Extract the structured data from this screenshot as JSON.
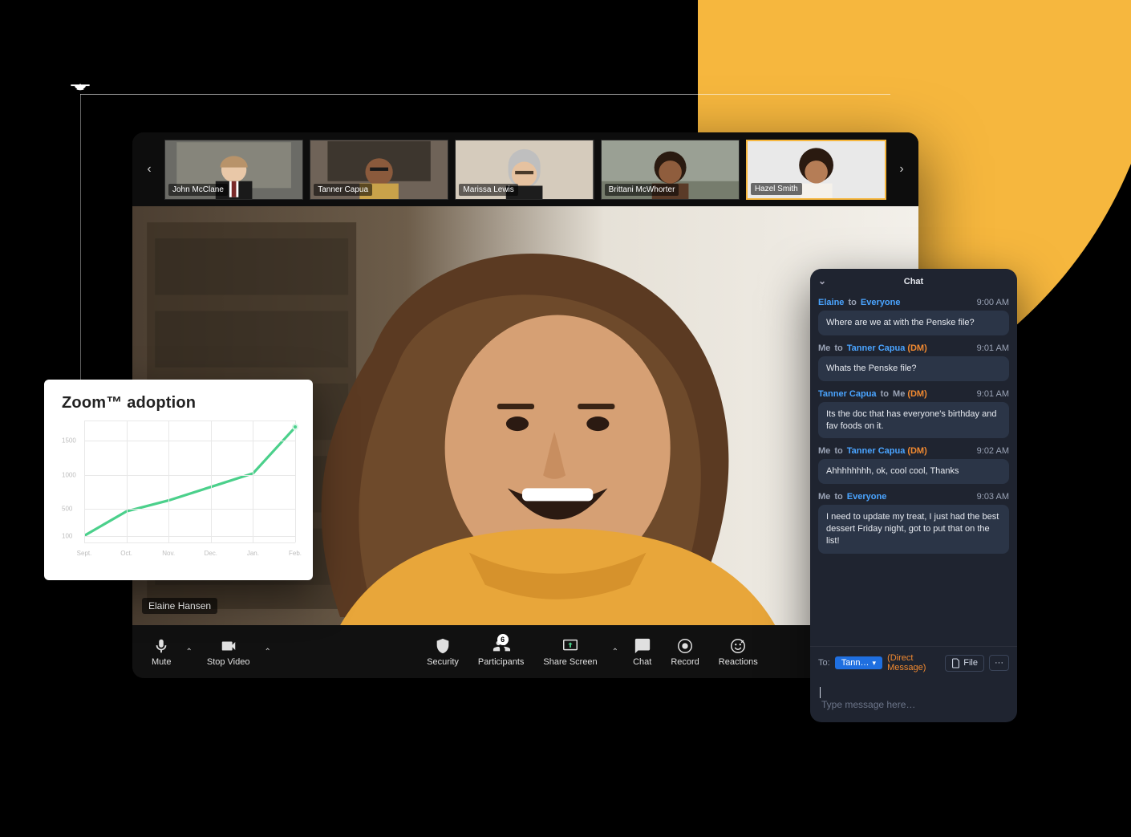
{
  "zoom": {
    "nav_prev": "‹",
    "nav_next": "›",
    "participants": [
      {
        "name": "John McClane"
      },
      {
        "name": "Tanner Capua"
      },
      {
        "name": "Marissa Lewis"
      },
      {
        "name": "Brittani McWhorter"
      },
      {
        "name": "Hazel Smith",
        "active": true
      }
    ],
    "speaker_name": "Elaine Hansen",
    "controls": {
      "mute": "Mute",
      "stop_video": "Stop Video",
      "security": "Security",
      "participants": "Participants",
      "participants_count": "6",
      "share": "Share Screen",
      "chat": "Chat",
      "record": "Record",
      "reactions": "Reactions"
    }
  },
  "chat": {
    "title": "Chat",
    "messages": [
      {
        "from": "Elaine",
        "from_blue": true,
        "to": "Everyone",
        "to_blue": true,
        "dm": false,
        "time": "9:00 AM",
        "text": "Where are we at with the Penske file?"
      },
      {
        "from": "Me",
        "from_blue": false,
        "to": "Tanner Capua",
        "to_blue": true,
        "dm": true,
        "time": "9:01 AM",
        "text": "Whats the Penske file?"
      },
      {
        "from": "Tanner Capua",
        "from_blue": true,
        "to": "Me",
        "to_blue": false,
        "dm": true,
        "time": "9:01 AM",
        "text": "Its the doc that has everyone's birthday and fav foods on it."
      },
      {
        "from": "Me",
        "from_blue": false,
        "to": "Tanner Capua",
        "to_blue": true,
        "dm": true,
        "time": "9:02 AM",
        "text": "Ahhhhhhhh, ok, cool cool, Thanks"
      },
      {
        "from": "Me",
        "from_blue": false,
        "to": "Everyone",
        "to_blue": true,
        "dm": false,
        "time": "9:03 AM",
        "text": "I need to update my treat, I just had the best dessert Friday night, got to put that on the list!"
      }
    ],
    "to_label": "To:",
    "to_pill": "Tann…",
    "to_suffix": "(Direct Message)",
    "file_btn": "File",
    "more_btn": "···",
    "input_placeholder": "Type message here…"
  },
  "chart_data": {
    "type": "line",
    "title": "Zoom™ adoption",
    "categories": [
      "Sept.",
      "Oct.",
      "Nov.",
      "Dec.",
      "Jan.",
      "Feb."
    ],
    "values": [
      100,
      460,
      620,
      820,
      1020,
      1700
    ],
    "y_ticks": [
      100,
      500,
      1000,
      1500
    ],
    "ylim": [
      0,
      1800
    ],
    "xlabel": "",
    "ylabel": ""
  }
}
